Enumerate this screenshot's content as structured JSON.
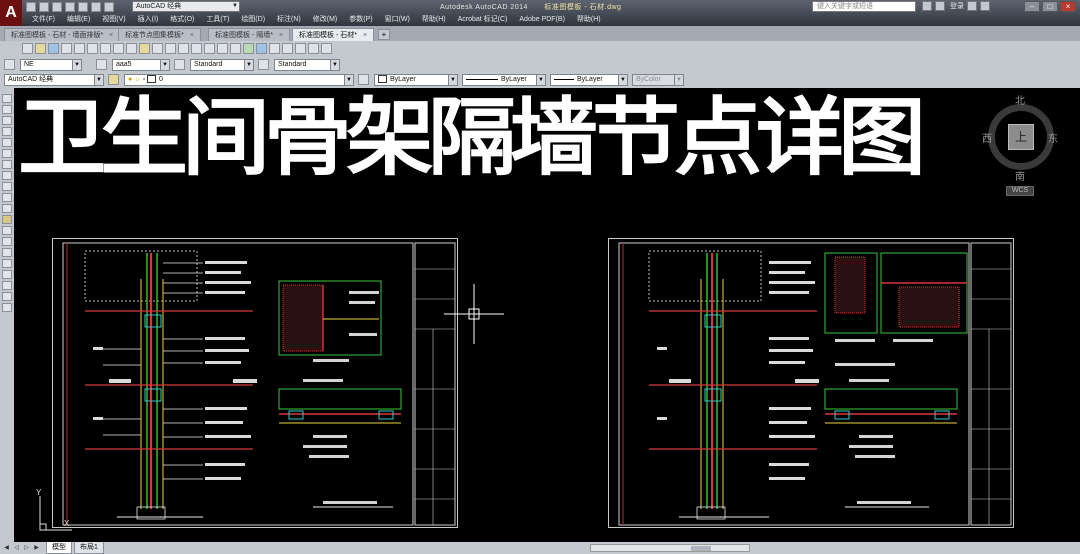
{
  "app": {
    "logo": "A",
    "window_title": "Autodesk AutoCAD 2014",
    "file_title": "标准图模板 - 石材.dwg",
    "workspace": "AutoCAD 经典",
    "search_placeholder": "键入关键字或短语",
    "login_label": "登录"
  },
  "menubar": [
    "文件(F)",
    "编辑(E)",
    "视图(V)",
    "插入(I)",
    "格式(O)",
    "工具(T)",
    "绘图(D)",
    "标注(N)",
    "修改(M)",
    "参数(P)",
    "窗口(W)",
    "帮助(H)",
    "Acrobat 标记(C)",
    "Adobe PDF(B)",
    "帮助(H)"
  ],
  "doc_tabs": [
    {
      "label": "标准图模板 - 石材 - 墙面排版*"
    },
    {
      "label": "标准节点图集模板*"
    },
    {
      "label": "标准图模板 - 隔墙*"
    },
    {
      "label": "标准图模板 - 石材*",
      "active": true
    }
  ],
  "toolbars": {
    "layer_combo": "0",
    "textstyle": "aaa5",
    "dimstyle": "Standard",
    "tablestyle": "Standard",
    "multileaderstyle": "Standard",
    "workspace_combo": "AutoCAD 经典",
    "color": "ByLayer",
    "linetype": "ByLayer",
    "lineweight": "ByLayer",
    "plotstyle": "ByColor",
    "ucs_name": "NE"
  },
  "drawing": {
    "title": "卫生间骨架隔墙节点详图"
  },
  "viewcube": {
    "north": "北",
    "south": "南",
    "west": "西",
    "east": "东",
    "face": "上",
    "wcs": "WCS"
  },
  "ucs_icon": {
    "x": "X",
    "y": "Y"
  },
  "layout_tabs": [
    {
      "label": "模型",
      "active": true
    },
    {
      "label": "布局1"
    }
  ]
}
